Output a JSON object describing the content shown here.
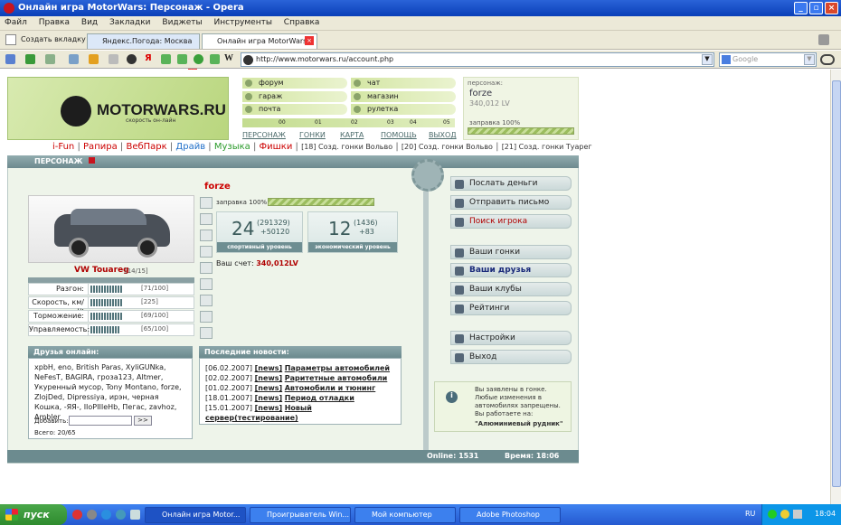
{
  "window": {
    "title": "Онлайн игра MotorWars: Персонаж - Opera"
  },
  "menu": [
    "Файл",
    "Правка",
    "Вид",
    "Закладки",
    "Виджеты",
    "Инструменты",
    "Справка"
  ],
  "tabs": {
    "new_tab": "Создать вкладку",
    "tab1": "Яндекс.Погода: Москва",
    "tab2": "Онлайн игра MotorWars..."
  },
  "address": {
    "url": "http://www.motorwars.ru/account.php",
    "search_placeholder": "Google"
  },
  "logo": {
    "name": "MOTORWARS.RU",
    "tagline": "скорость он-лайн"
  },
  "topmenu": {
    "forum": "форум",
    "chat": "чат",
    "garage": "гараж",
    "shop": "магазин",
    "mail": "почта",
    "roulette": "рулетка"
  },
  "gauge_ticks": [
    "00",
    "01",
    "02",
    "03",
    "04",
    "05"
  ],
  "navlinks": [
    "ПЕРСОНАЖ",
    "ГОНКИ",
    "КАРТА",
    "ПОМОЩЬ",
    "ВЫХОД"
  ],
  "userbox": {
    "label": "персонаж:",
    "name": "forze",
    "money": "340,012 LV",
    "fuel": "заправка 100%",
    "fuel_fraction": 1.0
  },
  "subnav": {
    "links": [
      "i-Fun",
      "Рапира",
      "ВебПарк",
      "Драйв",
      "Музыка",
      "Фишки"
    ],
    "sep": "|",
    "races": [
      "[18] Созд. гонки Вольво",
      "[20] Созд. гонки Вольво",
      "[21] Созд. гонки Туарег"
    ]
  },
  "section_title": "ПЕРСОНАЖ",
  "car": {
    "name": "VW Touareg",
    "count": "[14/15]"
  },
  "stats": [
    {
      "label": "Разгон:",
      "value": "[71/100]",
      "fraction": 0.71
    },
    {
      "label": "Скорость, км/ч:",
      "value": "[225]",
      "fraction": 0.72
    },
    {
      "label": "Торможение:",
      "value": "[69/100]",
      "fraction": 0.69
    },
    {
      "label": "Управляемость:",
      "value": "[65/100]",
      "fraction": 0.65
    }
  ],
  "player": {
    "name": "forze",
    "fuel": "заправка 100%",
    "fuel_fraction": 1.0
  },
  "sport_level": {
    "level": "24",
    "points": "(291329)",
    "gain": "+50120",
    "label": "спортивный уровень"
  },
  "econ_level": {
    "level": "12",
    "points": "(1436)",
    "gain": "+83",
    "label": "экономический уровень"
  },
  "account": {
    "label": "Ваш счет:",
    "value": "340,012LV"
  },
  "friends": {
    "title": "Друзья онлайн:",
    "list": "xpbH, eno, British Paras, XyliGUNka, NeFesT, BAGIRA, гроза123, Altmer, Укуренный мусор, Tony Montano, forze, ZlojDed, Dipressiya, ирэн, черная Кошка, -ЯЯ-, IIoPIIIeHb, Пегас, zavhoz, Ambler",
    "add_label": "Добавить:",
    "add_button": ">>",
    "total": "Всего: 20/65"
  },
  "news": {
    "title": "Последние новости:",
    "items": [
      {
        "date": "[06.02.2007]",
        "tag": "[news]",
        "text": "Параметры автомобилей"
      },
      {
        "date": "[02.02.2007]",
        "tag": "[news]",
        "text": "Раритетные автомобили"
      },
      {
        "date": "[01.02.2007]",
        "tag": "[news]",
        "text": "Автомобили и тюнинг"
      },
      {
        "date": "[18.01.2007]",
        "tag": "[news]",
        "text": "Период отладки"
      },
      {
        "date": "[15.01.2007]",
        "tag": "[news]",
        "text": "Новый"
      }
    ],
    "last_line": "сервер(тестирование)"
  },
  "side": {
    "group1": [
      "Послать деньги",
      "Отправить письмо",
      "Поиск игрока"
    ],
    "group2": [
      "Ваши гонки",
      "Ваши друзья",
      "Ваши клубы",
      "Рейтинги"
    ],
    "group3": [
      "Настройки",
      "Выход"
    ]
  },
  "notice": {
    "text": "Вы заявлены в гонке. Любые изменения в автомобилях запрещены. Вы работаете на:",
    "place": "\"Алюминиевый рудник\""
  },
  "footer": {
    "online": "Online: 1531",
    "time": "Время: 18:06"
  },
  "taskbar": {
    "start": "пуск",
    "items": [
      "Онлайн игра Motor...",
      "Проигрыватель Win...",
      "Мой компьютер",
      "Adobe Photoshop"
    ],
    "lang": "RU",
    "clock": "18:04"
  },
  "colors": {
    "accent_red": "#c8141e",
    "link_red": "#b00000",
    "green": "#b9d67e",
    "teal": "#6d8a8f"
  }
}
